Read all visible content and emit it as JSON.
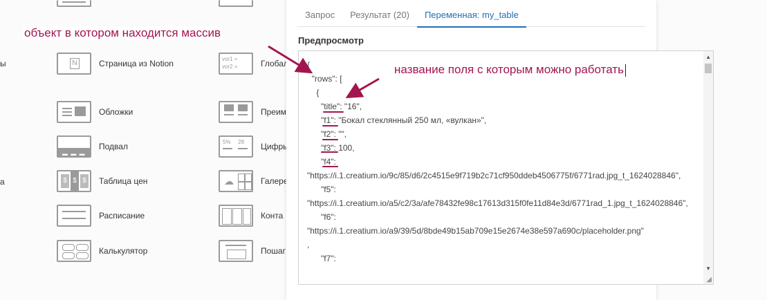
{
  "left_blocks": [
    {
      "name": "notion",
      "label": "Страница из Notion"
    },
    {
      "name": "covers",
      "label": "Обложки"
    },
    {
      "name": "footer",
      "label": "Подвал"
    },
    {
      "name": "pricing",
      "label": "Таблица цен"
    },
    {
      "name": "schedule",
      "label": "Расписание"
    },
    {
      "name": "calculator",
      "label": "Калькулятор"
    }
  ],
  "mid_blocks": [
    {
      "name": "global",
      "label": "Глобал"
    },
    {
      "name": "benefits",
      "label": "Преим"
    },
    {
      "name": "figures",
      "label": "Цифры"
    },
    {
      "name": "gallery",
      "label": "Галере"
    },
    {
      "name": "contacts",
      "label": "Конта"
    },
    {
      "name": "steps",
      "label": "Пошаг"
    }
  ],
  "edge_texts": {
    "t1": "ы",
    "t2": "а"
  },
  "thumb_texts": {
    "vars": "vor1 =\nvor2 ="
  },
  "tabs": [
    {
      "label": "Запрос",
      "active": false
    },
    {
      "label": "Результат (20)",
      "active": false
    },
    {
      "label": "Переменная: my_table",
      "active": true
    }
  ],
  "preview_title": "Предпросмотр",
  "code_text": "{\n  \"rows\": [\n    {\n      \"title\": \"16\",\n      \"f1\": \"Бокал стеклянный 250 мл, «вулкан»\",\n      \"f2\": \"\",\n      \"f3\": 100,\n      \"f4\":\n\"https://i.1.creatium.io/9c/85/d6/2c4515e9f719b2c71cf950ddeb4506775f/6771rad.jpg_t_1624028846\",\n      \"f5\":\n\"https://i.1.creatium.io/a5/c2/3a/afe78432fe98c17613d315f0fe11d84e3d/6771rad_1.jpg_t_1624028846\",\n      \"f6\":\n\"https://i.1.creatium.io/a9/39/5d/8bde49b15ab709e15e2674e38e597a690c/placeholder.png\"\n,\n      \"f7\":",
  "annotations": {
    "array_object": "объект в котором находится массив",
    "field_name": "название поля с которым можно работать"
  },
  "colors": {
    "accent": "#1f6fb5",
    "annotation": "#a3154f"
  }
}
